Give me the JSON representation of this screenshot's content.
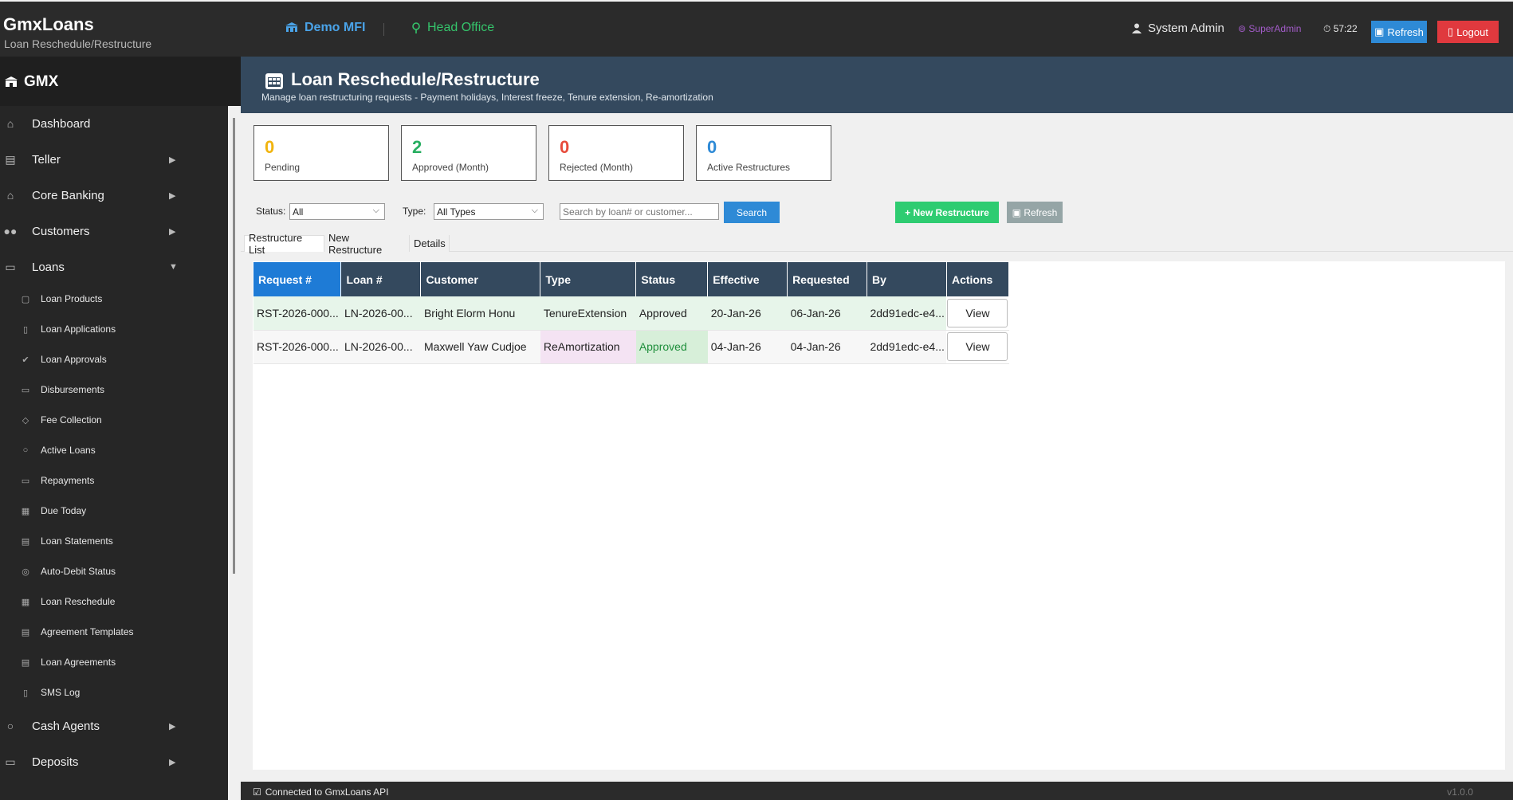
{
  "topbar": {
    "app_title": "GmxLoans",
    "app_subtitle": "Loan Reschedule/Restructure",
    "org_name": "Demo MFI",
    "branch_name": "Head Office",
    "user_name": "System Admin",
    "role": "SuperAdmin",
    "session_timer": "57:22",
    "refresh_label": "Refresh",
    "logout_label": "Logout"
  },
  "sidebar": {
    "brand": "GMX",
    "items": [
      {
        "label": "Dashboard",
        "icon": "house-icon"
      },
      {
        "label": "Teller",
        "icon": "teller-icon"
      },
      {
        "label": "Core Banking",
        "icon": "bank-icon"
      },
      {
        "label": "Customers",
        "icon": "people-icon"
      },
      {
        "label": "Loans",
        "icon": "cash-icon"
      },
      {
        "label": "Cash Agents",
        "icon": "moneybag-icon"
      },
      {
        "label": "Deposits",
        "icon": "atm-icon"
      }
    ],
    "loans_sub": [
      {
        "label": "Loan Products",
        "icon": "box-icon"
      },
      {
        "label": "Loan Applications",
        "icon": "document-icon"
      },
      {
        "label": "Loan Approvals",
        "icon": "check-icon"
      },
      {
        "label": "Disbursements",
        "icon": "card-icon"
      },
      {
        "label": "Fee Collection",
        "icon": "tag-icon"
      },
      {
        "label": "Active Loans",
        "icon": "moneybag-icon"
      },
      {
        "label": "Repayments",
        "icon": "card-icon"
      },
      {
        "label": "Due Today",
        "icon": "calendar-icon"
      },
      {
        "label": "Loan Statements",
        "icon": "statement-icon"
      },
      {
        "label": "Auto-Debit Status",
        "icon": "sync-icon"
      },
      {
        "label": "Loan Reschedule",
        "icon": "calendar-icon"
      },
      {
        "label": "Agreement Templates",
        "icon": "document-icon"
      },
      {
        "label": "Loan Agreements",
        "icon": "document-icon"
      },
      {
        "label": "SMS Log",
        "icon": "phone-icon"
      }
    ]
  },
  "header": {
    "title": "Loan Reschedule/Restructure",
    "subtitle": "Manage loan restructuring requests - Payment holidays, Interest freeze, Tenure extension, Re-amortization"
  },
  "stats": [
    {
      "value": "0",
      "label": "Pending",
      "color": "#f1b40f"
    },
    {
      "value": "2",
      "label": "Approved (Month)",
      "color": "#27ae60"
    },
    {
      "value": "0",
      "label": "Rejected (Month)",
      "color": "#e74c3c"
    },
    {
      "value": "0",
      "label": "Active Restructures",
      "color": "#2e8ad6"
    }
  ],
  "filters": {
    "status_label": "Status:",
    "status_value": "All",
    "type_label": "Type:",
    "type_value": "All Types",
    "search_placeholder": "Search by loan# or customer...",
    "search_button": "Search",
    "new_button": "+ New Restructure",
    "refresh_button": "Refresh"
  },
  "tabs": [
    "Restructure List",
    "New Restructure",
    "Details"
  ],
  "table": {
    "columns": [
      "Request #",
      "Loan #",
      "Customer",
      "Type",
      "Status",
      "Effective",
      "Requested",
      "By",
      "Actions"
    ],
    "rows": [
      {
        "request": "RST-2026-000...",
        "loan": "LN-2026-00...",
        "customer": "Bright Elorm Honu",
        "type": "TenureExtension",
        "status": "Approved",
        "effective": "20-Jan-26",
        "requested": "06-Jan-26",
        "by": "2dd91edc-e4...",
        "action": "View"
      },
      {
        "request": "RST-2026-000...",
        "loan": "LN-2026-00...",
        "customer": "Maxwell Yaw Cudjoe",
        "type": "ReAmortization",
        "status": "Approved",
        "effective": "04-Jan-26",
        "requested": "04-Jan-26",
        "by": "2dd91edc-e4...",
        "action": "View"
      }
    ]
  },
  "statusbar": {
    "text": "Connected to GmxLoans API",
    "version": "v1.0.0"
  }
}
